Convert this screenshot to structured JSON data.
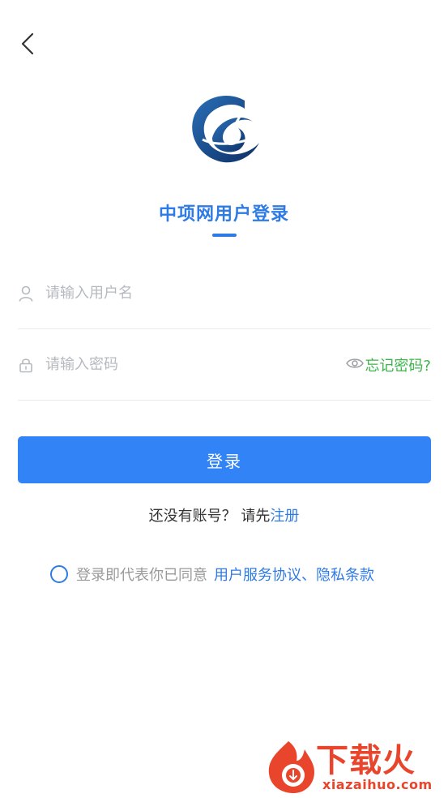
{
  "header": {
    "back_icon": "chevron-left-icon"
  },
  "brand": {
    "logo_icon": "zhongxiang-logo-icon",
    "title": "中项网用户登录",
    "accent_color": "#2f7be5"
  },
  "form": {
    "username": {
      "icon": "user-icon",
      "placeholder": "请输入用户名",
      "value": ""
    },
    "password": {
      "icon": "lock-icon",
      "placeholder": "请输入密码",
      "value": "",
      "toggle_icon": "eye-icon",
      "forgot_label": "忘记密码?"
    },
    "submit_label": "登录",
    "submit_color": "#3283f5"
  },
  "register": {
    "prompt": "还没有账号？",
    "pre_link": "请先",
    "link_label": "注册"
  },
  "agreement": {
    "checked": false,
    "text": "登录即代表你已同意",
    "service_link": "用户服务协议",
    "separator": "、",
    "privacy_link": "隐私条款"
  },
  "watermark": {
    "brand_text": "下载火",
    "domain": "xiazaihuo.com",
    "color": "#e8452c"
  }
}
